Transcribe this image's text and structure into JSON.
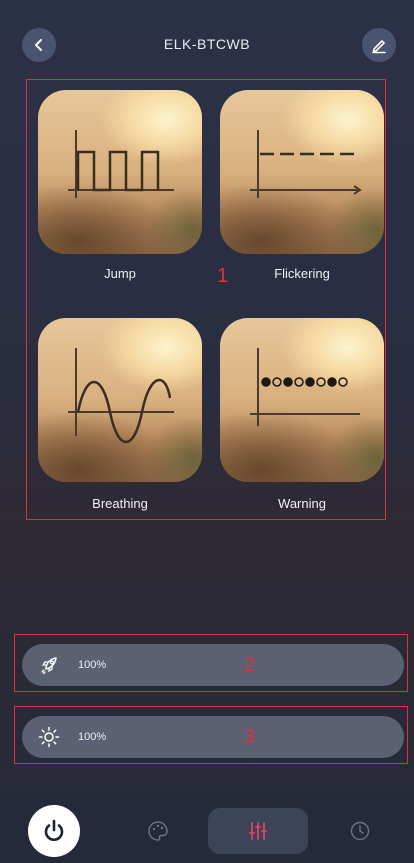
{
  "header": {
    "title": "ELK-BTCWB"
  },
  "modes": [
    {
      "label": "Jump"
    },
    {
      "label": "Flickering"
    },
    {
      "label": "Breathing"
    },
    {
      "label": "Warning"
    }
  ],
  "annotations": {
    "box1": "1",
    "box2": "2",
    "box3": "3"
  },
  "sliders": {
    "speed": {
      "value": "100%",
      "icon": "rocket-icon"
    },
    "brightness": {
      "value": "100%",
      "icon": "sun-icon"
    }
  },
  "nav": {
    "items": [
      "power-icon",
      "palette-icon",
      "sliders-icon",
      "clock-icon"
    ],
    "active": "sliders-icon"
  },
  "colors": {
    "accent": "#d8343a",
    "active_tab_icon": "#e2435d",
    "background": "#2b3147"
  }
}
